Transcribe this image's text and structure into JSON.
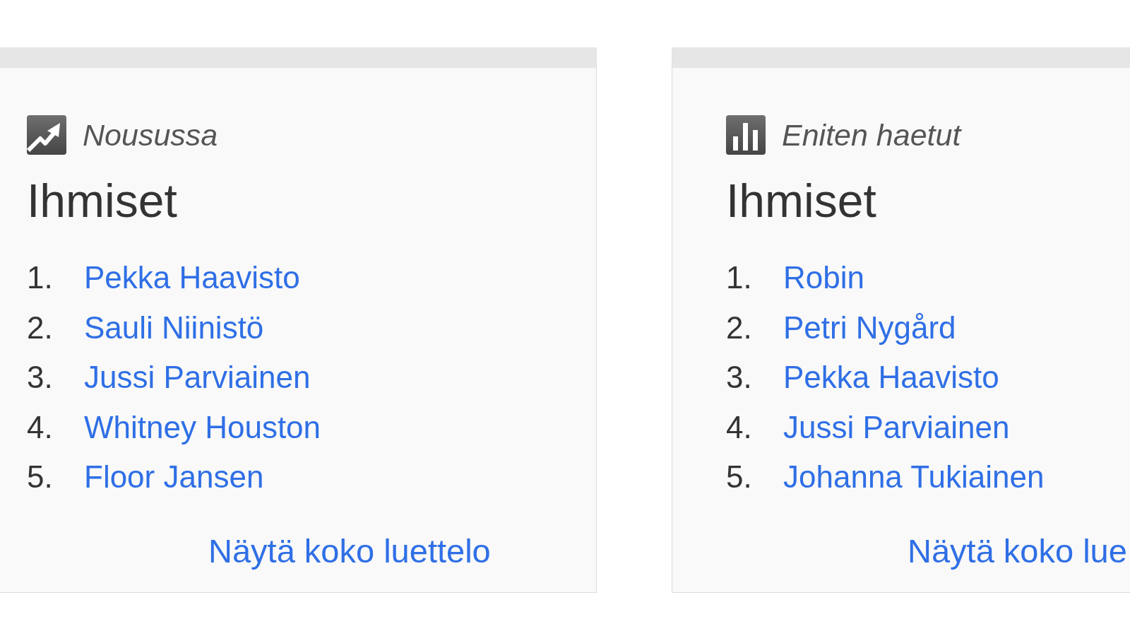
{
  "cards": [
    {
      "kind": "rising",
      "label": "Nousussa",
      "title": "Ihmiset",
      "items": [
        {
          "rank": "1.",
          "name": "Pekka Haavisto"
        },
        {
          "rank": "2.",
          "name": "Sauli Niinistö"
        },
        {
          "rank": "3.",
          "name": "Jussi Parviainen"
        },
        {
          "rank": "4.",
          "name": "Whitney Houston"
        },
        {
          "rank": "5.",
          "name": "Floor Jansen"
        }
      ],
      "more_link": "Näytä koko luettelo"
    },
    {
      "kind": "top",
      "label": "Eniten haetut",
      "title": "Ihmiset",
      "items": [
        {
          "rank": "1.",
          "name": "Robin"
        },
        {
          "rank": "2.",
          "name": "Petri Nygård"
        },
        {
          "rank": "3.",
          "name": "Pekka Haavisto"
        },
        {
          "rank": "4.",
          "name": "Jussi Parviainen"
        },
        {
          "rank": "5.",
          "name": "Johanna Tukiainen"
        }
      ],
      "more_link": "Näytä koko lue"
    }
  ]
}
